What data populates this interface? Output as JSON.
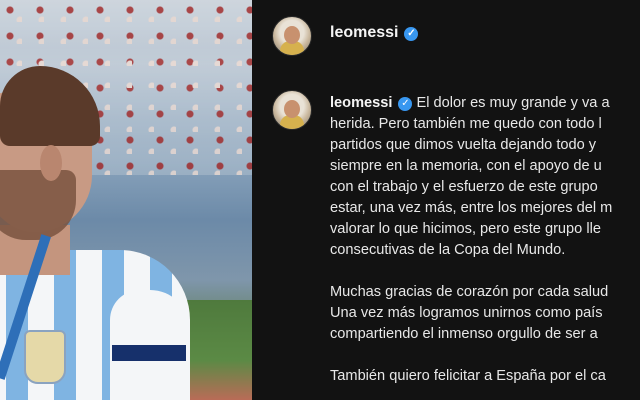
{
  "post": {
    "username": "leomessi",
    "verified_icon": "verified-badge-icon",
    "accent": "#3897f0"
  },
  "caption": {
    "username": "leomessi",
    "first_line_text": "El dolor es muy grande y va a",
    "lines": [
      "herida. Pero también me quedo con todo l",
      "partidos que dimos vuelta dejando todo y",
      "siempre en la memoria, con el apoyo de u",
      "con el trabajo y el esfuerzo de este grupo",
      "estar, una vez más, entre los mejores del m",
      "valorar lo que hicimos, pero este grupo lle",
      "consecutivas de la Copa del Mundo."
    ],
    "paragraph2": [
      "Muchas gracias de corazón por cada salud",
      "Una vez más logramos unirnos como país",
      "compartiendo el inmenso orgullo de ser a"
    ],
    "paragraph3": [
      "También quiero felicitar a España por el ca"
    ]
  }
}
